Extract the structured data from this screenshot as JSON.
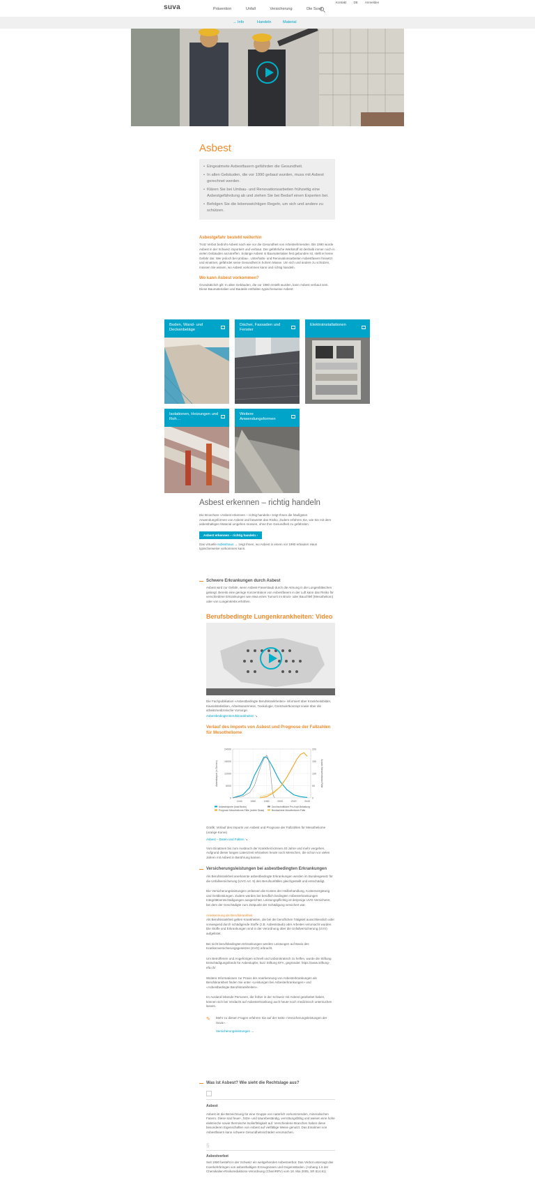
{
  "header": {
    "logo": "suva",
    "nav": [
      "Prävention",
      "Unfall",
      "Versicherung",
      "Die Suva"
    ],
    "util": [
      "Kontakt",
      "DE",
      "Anmelden"
    ]
  },
  "subnav": [
    "Info",
    "Handeln",
    "Material"
  ],
  "page": {
    "title": "Asbest",
    "bullets": [
      "Eingeatmete Asbestfasern gefährden die Gesundheit.",
      "In allen Gebäuden, die vor 1990 gebaut wurden, muss mit Asbest gerechnet werden.",
      "Klären Sie bei Umbau- und Renovationsarbeiten frühzeitig eine Asbestgefährdung ab und ziehen Sie bei Bedarf einen Experten bei.",
      "Befolgen Sie die lebenswichtigen Regeln, um sich und andere zu schützen."
    ],
    "s1_title": "Asbestgefahr besteht weiterhin",
    "s1_text": "Trotz Verbot bedroht Asbest nach wie vor die Gesundheit von Arbeitnehmenden. Bis 1990 wurde Asbest in der Schweiz importiert und verbaut. Der gefährliche Werkstoff ist deshalb immer noch in vielen Gebäuden anzutreffen. Solange Asbest in Baumaterialien fest gebunden ist, stellt er keine Gefahr dar. Wer jedoch bei Umbau-, Unterhalts- und Renovationsarbeiten Asbestfasern freisetzt und einatmet, gefährdet seine Gesundheit in hohem Masse. Um sich und andere zu schützen, müssen Sie wissen, wo Asbest vorkommen kann und richtig handeln.",
    "s2_title": "Wo kann Asbest vorkommen?",
    "s2_text": "Grundsätzlich gilt: In allen Gebäuden, die vor 1990 erstellt wurden, kann Asbest verbaut sein. Diese Baumaterialien und Bauteile enthalten typischerweise Asbest:",
    "tiles": [
      "Boden, Wand- und Deckenbeläge",
      "Dächer, Fassaden und Fenster",
      "Elektroinstallationen",
      "Isolationen, Heizungen und Roh…",
      "Weitere Anwendungsformen"
    ],
    "h2": "Asbest erkennen – richtig handeln",
    "h2_text": "Die Broschüre «Asbest erkennen – richtig handeln» zeigt Ihnen die häufigsten Anwendungsformen von Asbest und bewertet das Risiko. Zudem erfahren Sie, wie Sie mit dem asbesthaltigen Material umgehen müssen, ohne Ihre Gesundheit zu gefährden.",
    "btn": "Asbest erkennen – richtig handeln",
    "haus_a": "Das virtuelle",
    "haus_link": "Asbesthaus",
    "haus_b": "zeigt Ihnen, wo Asbest in einem vor 1990 erbauten Haus typischerweise vorkommen kann.",
    "acc1_title": "Schwere Erkrankungen durch Asbest",
    "acc1_text": "Asbest wird zur Gefahr, wenn Asbest-Faserstaub durch die Atmung in die Lungenbläschen gelangt. Bereits eine geringe Konzentration von Asbestfasern in der Luft kann das Risiko für verschiedene Erkrankungen wie etwa eines Tumors im Brust- oder Bauchfell (Mesotheliom) oder von Lungenkrebs erhöhen.",
    "video_title": "Berufsbedingte Lungenkrankheiten: Video",
    "video_text": "Die Fachpublikation «Asbestbedingte Berufskrankheiten» informiert über Krankheitsbilder, Kausalstatistiken, Arbeitsanamnese, Toxikologie, Grenzwertkonzept sowie über die arbeitsmedizinische Vorsorge.",
    "video_link": "Asbestbedingte Berufskrankheiten",
    "chart_title": "Verlauf des Imports von Asbest und Prognose der Fallzahlen für Mesotheliome",
    "chart_caption": "Grafik: Verlauf des Imports von Asbest und Prognose der Fallzahlen für Mesotheliome (orange Kurve)",
    "chart_link": "Asbest – Daten und Fakten",
    "chart_text": "Vom Einatmen bis zum Ausbruch der Krankheit können 40 Jahre und mehr vergehen. Aufgrund dieser langen Latenzzeit erkranken heute noch Menschen, die schon vor vielen Jahren mit Asbest in Berührung kamen.",
    "acc2_title": "Versicherungsleistungen bei asbestbedingten Erkrankungen",
    "acc2_p1": "Als Berufskrankheit anerkannte asbestbedingte Erkrankungen werden im Bundesgesetz für die Unfallversicherung (UVG Art. 9) den Berufsunfällen gleichgestellt und entschädigt.",
    "acc2_p2": "Die Versicherungsleistungen umfassen die Kosten der Heilbehandlung, Kostenvergütung und Geldleistungen. Zudem werden bei beruflich bedingten Asbesterkrankungen Integritätsentschädigungen ausgerichtet. Leistungspflichtig ist derjenige UVG-Versicherer, bei dem der Geschädigte zum Zeitpunkt der Schädigung versichert war.",
    "acc2_h": "Anerkennung als Berufskrankheit",
    "acc2_p3": "Als Berufskrankheit gelten Krankheiten, die bei der beruflichen Tätigkeit ausschliesslich oder vorwiegend durch schädigende Stoffe (z.B. Asbeststaub) oder Arbeiten verursacht wurden. Die Stoffe und Erkrankungen sind in der Verordnung über die Unfallversicherung (UVV) aufgelistet.",
    "acc2_p4": "Bei nicht berufsbedingten Erkrankungen werden Leistungen auf Basis des Krankenversicherungsgesetzes (KVG) erbracht.",
    "acc2_p5": "Um Betroffenen und Angehörigen schnell und unbürokratisch zu helfen, wurde die Stiftung Entschädigungsfonds für Asbestopfer, kurz Stiftung EFA, gegründet: https://www.stiftung-efa.ch/",
    "acc2_p6": "Weitere Informationen zur Praxis der Anerkennung von Asbesterkrankungen als Berufskrankheit finden Sie unter «Leistungen bei Asbesterkrankungen» und «Asbestbedingte Berufskrankheiten».",
    "acc2_p7": "Im Ausland lebende Personen, die früher in der Schweiz mit Asbest gearbeitet haben, können sich bei Verdacht auf Asbesterkrankung auch heute noch medizinisch untersuchen lassen.",
    "acc2_tip": "Mehr zu diesen Fragen erfahren Sie auf der Seite «Versicherungsleistungen der Suva».",
    "acc2_link": "Versicherungsleistungen",
    "acc3_title": "Was ist Asbest? Wie sieht die Rechtslage aus?",
    "acc3_h1": "Asbest",
    "acc3_p1": "Asbest ist die Bezeichnung für eine Gruppe von natürlich vorkommenden, mineralischen Fasern. Diese sind feuer-, hitze- und säurebeständig, verrottungsfähig und weisen eine hohe elektrische sowie thermische Isolierfähigkeit auf. Verschiedene Branchen haben diese besonderen Eigenschaften von Asbest auf vielfältige Weise genutzt. Das Einatmen von Asbestfasern kann schwere Gesundheitsschäden verursachen.",
    "acc3_sym": "§",
    "acc3_h2": "Asbestverbot",
    "acc3_p2": "Seit 1990 besteht in der Schweiz ein weitgehendes Asbestverbot. Das Verbot untersagt das Inverkehrbringen von asbesthaltigen Erzeugnissen und Gegenständen. (Anhang 1.6 der Chemikalien-Risikoreduktions-Verordnung (ChemRRV) vom 18. Mai 2005, SR 814.81)"
  },
  "chart_data": {
    "type": "line",
    "title": "Verlauf des Imports von Asbest und Prognose der Fallzahlen für Mesotheliome",
    "ylabel": "Asbestimport (in Tonnen)",
    "y2label": "Anzahl Mesotheliome-Fälle",
    "x_ticks": [
      "1940",
      "1960",
      "1980",
      "2000",
      "2020",
      "2040"
    ],
    "y_ticks": [
      "0",
      "6000",
      "12000",
      "18000",
      "24000"
    ],
    "y2_ticks": [
      "0",
      "50",
      "100",
      "150",
      "200"
    ],
    "ylim": [
      0,
      24000
    ],
    "y2lim": [
      0,
      200
    ],
    "xlim": [
      1930,
      2045
    ],
    "series": [
      {
        "name": "Asbestimporte (total Brutto)",
        "color": "#00a4c8",
        "axis": "left",
        "x": [
          1930,
          1945,
          1955,
          1962,
          1970,
          1976,
          1980,
          1985,
          1990,
          1995,
          2000,
          2010,
          2020,
          2030,
          2040
        ],
        "values": [
          0,
          1500,
          5000,
          11000,
          16000,
          20000,
          20000,
          17500,
          14500,
          11000,
          8000,
          4000,
          1500,
          600,
          200
        ]
      },
      {
        "name": "Durchschnittliche Pro-Kopf-Belastung",
        "color": "#8a8a8a",
        "axis": "left",
        "x": [
          1930,
          1945,
          1955,
          1962,
          1968,
          1972,
          1976,
          1978,
          1980,
          1982,
          1985,
          1988,
          1990,
          1992
        ],
        "values": [
          0,
          800,
          2500,
          6000,
          12000,
          16000,
          19000,
          20000,
          21000,
          20000,
          15000,
          5000,
          1000,
          0
        ]
      },
      {
        "name": "Prognose Mesotheliome-Fälle (rechte Skala)",
        "color": "#f5a623",
        "axis": "right",
        "x": [
          1970,
          1980,
          1990,
          2000,
          2010,
          2020,
          2025,
          2030,
          2035,
          2040
        ],
        "values": [
          0,
          5,
          20,
          45,
          85,
          135,
          160,
          178,
          185,
          170
        ]
      },
      {
        "name": "Beobachtete Mesotheliome-Fälle",
        "color": "#e8c24a",
        "axis": "right",
        "x": [
          1970,
          1975,
          1980,
          1985,
          1990,
          1995,
          2000,
          2005
        ],
        "values": [
          5,
          8,
          12,
          18,
          25,
          35,
          45,
          60
        ]
      }
    ]
  }
}
